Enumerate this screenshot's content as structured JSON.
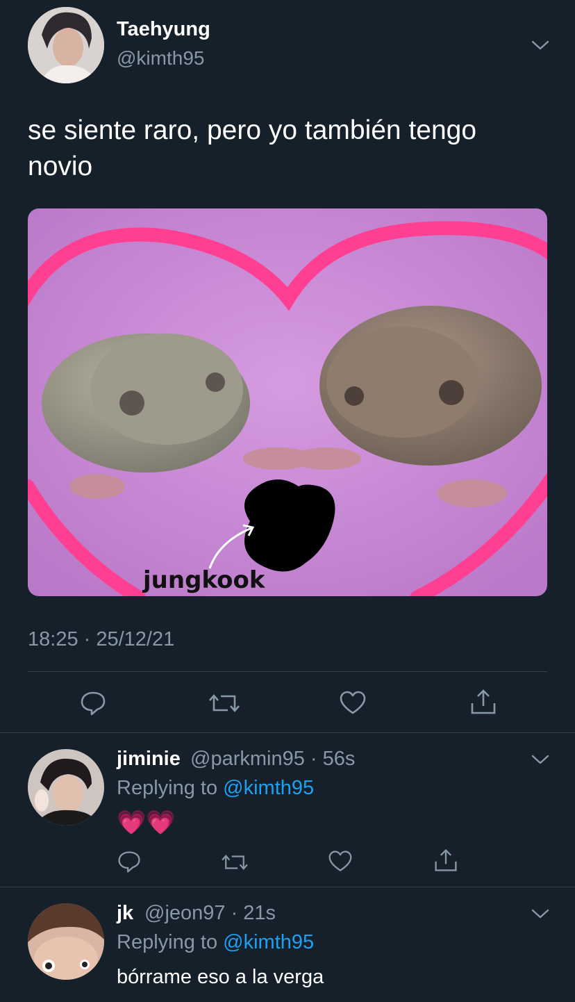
{
  "tweet": {
    "name": "Taehyung",
    "handle": "@kimth95",
    "text": "se siente raro, pero yo también tengo novio",
    "image_caption": "jungkook",
    "timestamp": "18:25 · 25/12/21"
  },
  "replies": [
    {
      "name": "jiminie",
      "handle_time": "@parkmin95 · 56s",
      "replying_prefix": "Replying to ",
      "replying_mention": "@kimth95",
      "text": "💗💗"
    },
    {
      "name": "jk",
      "handle_time": "@jeon97 · 21s",
      "replying_prefix": "Replying to ",
      "replying_mention": "@kimth95",
      "text": "bórrame eso a la verga"
    }
  ],
  "colors": {
    "background": "#15202b",
    "secondary_text": "#8899a6",
    "link": "#1da1f2",
    "divider": "#38444d"
  },
  "icons": [
    "reply-icon",
    "retweet-icon",
    "like-icon",
    "share-icon",
    "chevron-down-icon"
  ]
}
